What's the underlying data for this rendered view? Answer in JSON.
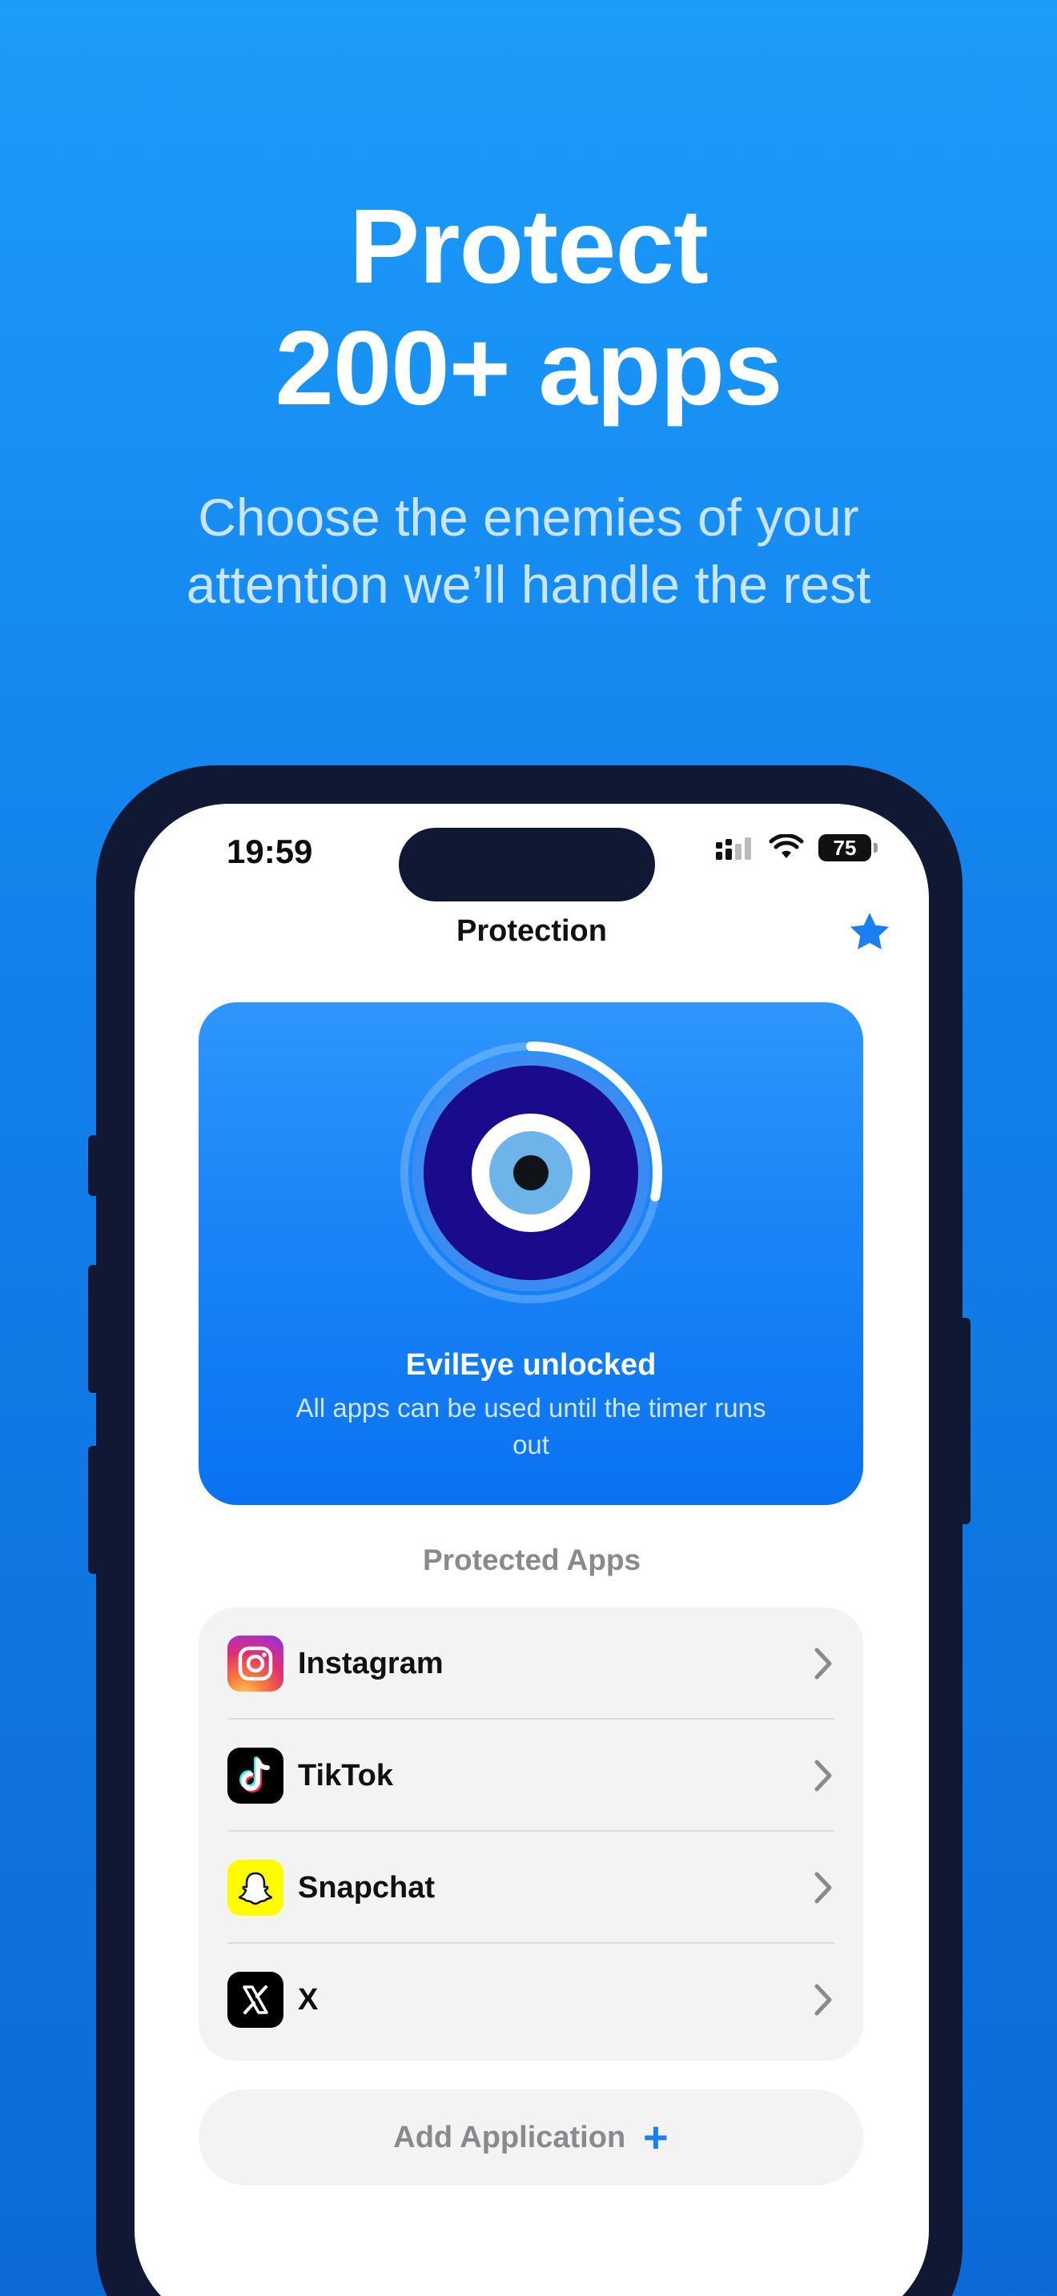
{
  "headline": {
    "line1": "Protect",
    "line2": "200+ apps"
  },
  "subline": {
    "line1": "Choose the enemies of your",
    "line2": "attention we’ll handle the rest"
  },
  "status_bar": {
    "time": "19:59",
    "battery": "75"
  },
  "nav": {
    "title": "Protection",
    "favorite_icon": "star-icon"
  },
  "hero": {
    "title": "EvilEye unlocked",
    "subtitle": "All apps can be used until the timer runs out",
    "timer_progress": 0.28,
    "icon": "evil-eye-icon"
  },
  "protected_apps": {
    "label": "Protected Apps",
    "items": [
      {
        "name": "Instagram",
        "icon": "instagram-icon"
      },
      {
        "name": "TikTok",
        "icon": "tiktok-icon"
      },
      {
        "name": "Snapchat",
        "icon": "snapchat-icon"
      },
      {
        "name": "X",
        "icon": "x-icon"
      }
    ]
  },
  "add_button": {
    "label": "Add Application",
    "icon": "plus-icon"
  },
  "colors": {
    "background_top": "#1c9cfb",
    "background_bottom": "#0b6ad6",
    "accent": "#1a7ff0",
    "phone_frame": "#111834",
    "eye_dark": "#1a0a8c"
  }
}
